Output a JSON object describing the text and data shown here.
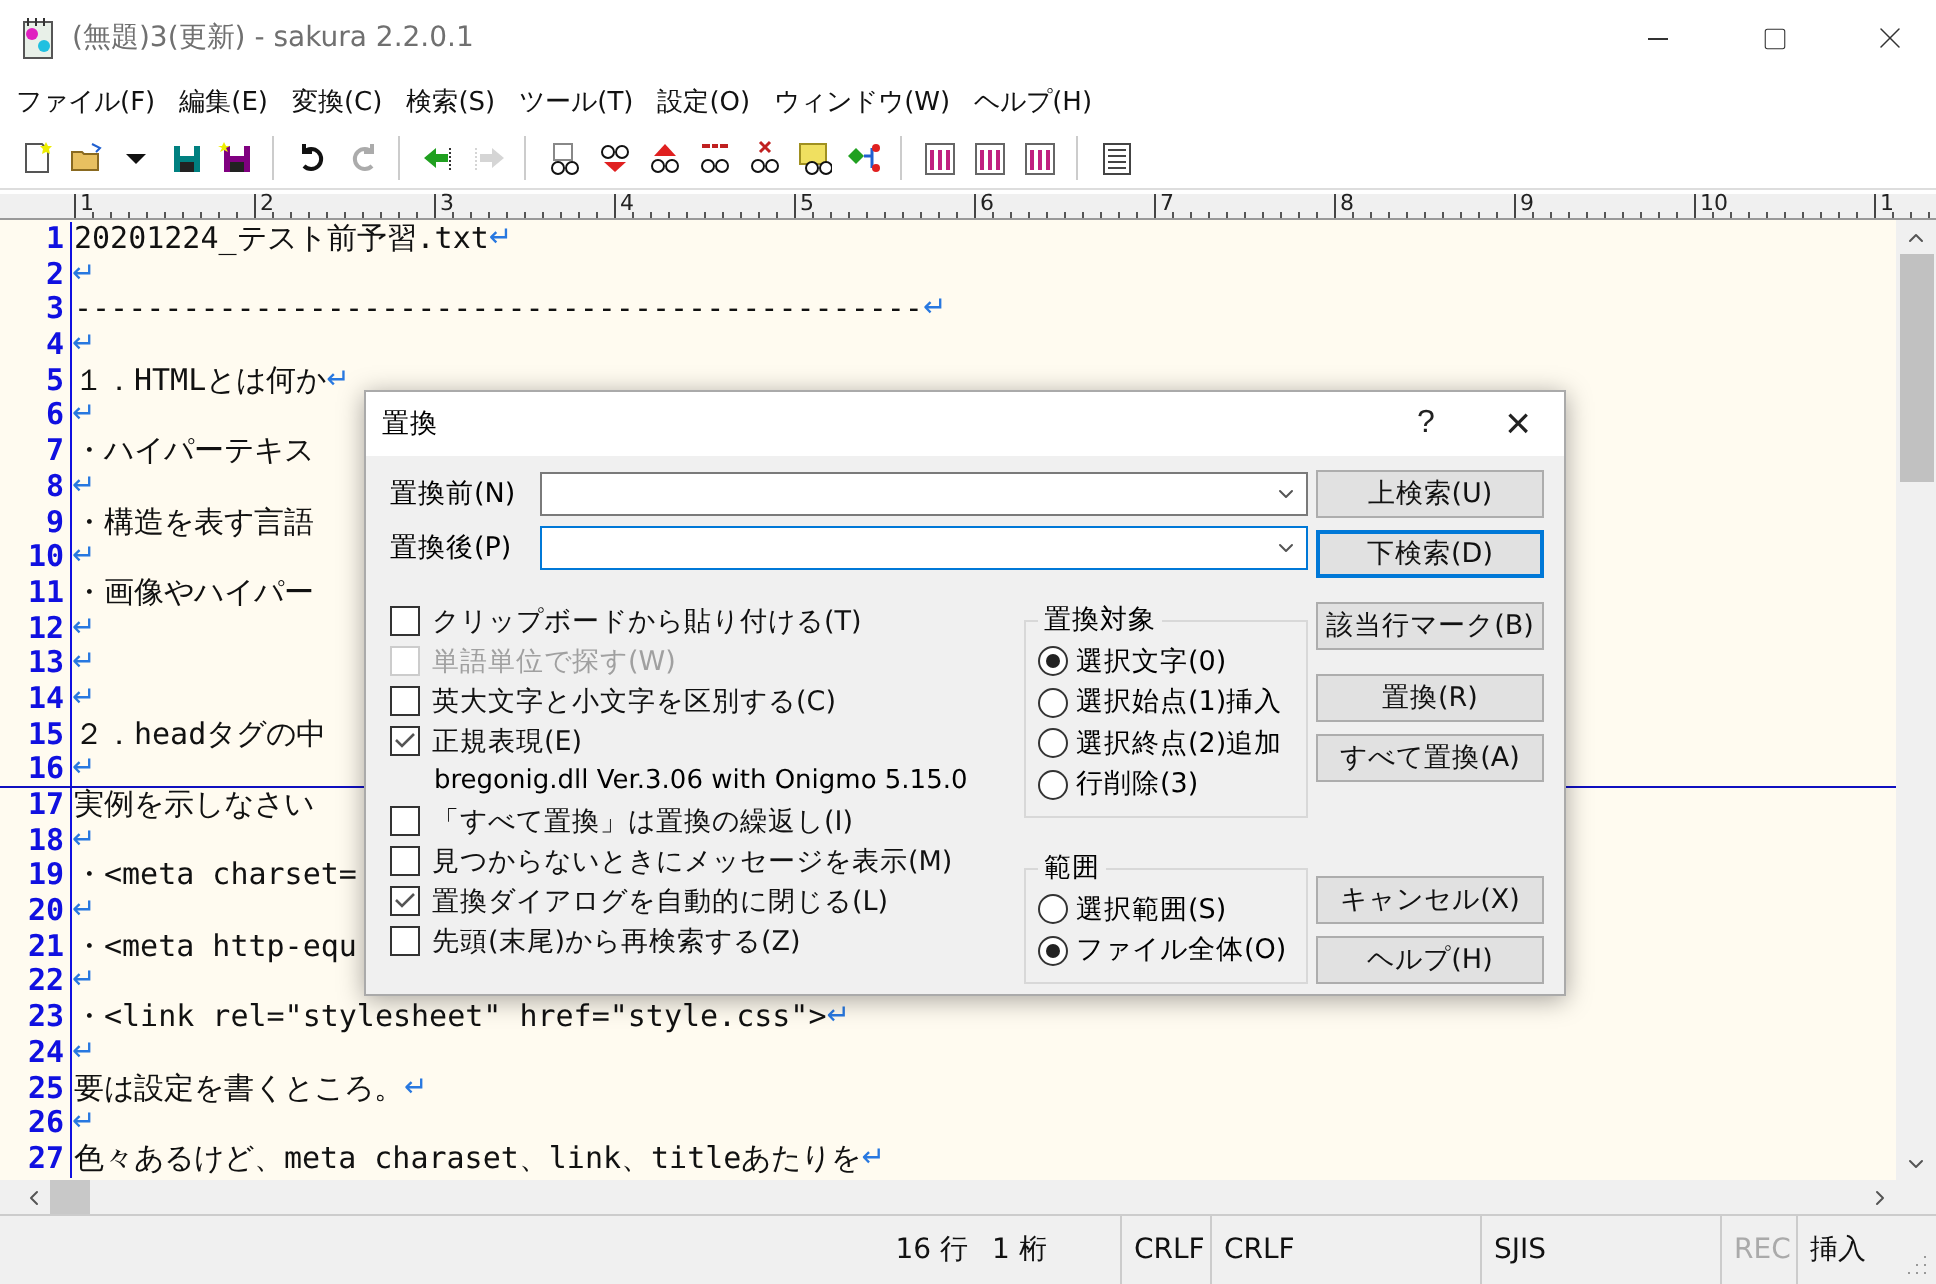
{
  "window": {
    "title": "(無題)3(更新) - sakura 2.2.0.1"
  },
  "menu": [
    "ファイル(F)",
    "編集(E)",
    "変換(C)",
    "検索(S)",
    "ツール(T)",
    "設定(O)",
    "ウィンドウ(W)",
    "ヘルプ(H)"
  ],
  "toolbar": [
    {
      "kind": "new",
      "disabled": false
    },
    {
      "kind": "open",
      "disabled": false
    },
    {
      "kind": "caret",
      "disabled": false
    },
    {
      "kind": "save",
      "disabled": false
    },
    {
      "kind": "saveas",
      "disabled": false
    },
    {
      "kind": "sep"
    },
    {
      "kind": "undo",
      "disabled": false
    },
    {
      "kind": "redo",
      "disabled": true
    },
    {
      "kind": "sep"
    },
    {
      "kind": "back",
      "disabled": false
    },
    {
      "kind": "forward",
      "disabled": true
    },
    {
      "kind": "sep"
    },
    {
      "kind": "find",
      "disabled": false
    },
    {
      "kind": "down",
      "disabled": false
    },
    {
      "kind": "up",
      "disabled": false
    },
    {
      "kind": "replace",
      "disabled": false
    },
    {
      "kind": "clear",
      "disabled": false
    },
    {
      "kind": "grep",
      "disabled": false
    },
    {
      "kind": "link",
      "disabled": false
    },
    {
      "kind": "sep"
    },
    {
      "kind": "tool",
      "disabled": false
    },
    {
      "kind": "tool",
      "disabled": false
    },
    {
      "kind": "tool",
      "disabled": false
    },
    {
      "kind": "sep"
    },
    {
      "kind": "list",
      "disabled": false
    }
  ],
  "ruler": {
    "marks": [
      "1",
      "2",
      "3",
      "4",
      "5",
      "6",
      "7",
      "8",
      "9",
      "10",
      "1"
    ]
  },
  "editor": {
    "lines": [
      {
        "num": "1",
        "text": "20201224_テスト前予習.txt",
        "eol": "↵",
        "current": false
      },
      {
        "num": "2",
        "eol": "↵",
        "current": false
      },
      {
        "num": "3",
        "text": "-----------------------------------------------",
        "eol": "↵",
        "current": false
      },
      {
        "num": "4",
        "eol": "↵",
        "current": false
      },
      {
        "num": "5",
        "text": "１．HTMLとは何か",
        "eol": "↵",
        "current": false
      },
      {
        "num": "6",
        "eol": "↵",
        "current": false
      },
      {
        "num": "7",
        "text": "・ハイパーテキス",
        "current": false
      },
      {
        "num": "8",
        "eol": "↵",
        "current": false
      },
      {
        "num": "9",
        "text": "・構造を表す言語",
        "current": false
      },
      {
        "num": "10",
        "eol": "↵",
        "current": false
      },
      {
        "num": "11",
        "text": "・画像やハイパー",
        "current": false
      },
      {
        "num": "12",
        "eol": "↵",
        "current": false
      },
      {
        "num": "13",
        "eol": "↵",
        "current": false
      },
      {
        "num": "14",
        "eol": "↵",
        "current": false
      },
      {
        "num": "15",
        "text": "２．headタグの中",
        "current": false
      },
      {
        "num": "16",
        "eol": "↵",
        "current": true
      },
      {
        "num": "17",
        "text": "実例を示しなさい",
        "current": false
      },
      {
        "num": "18",
        "eol": "↵",
        "current": false
      },
      {
        "num": "19",
        "text": "・<meta charset=",
        "current": false
      },
      {
        "num": "20",
        "eol": "↵",
        "current": false
      },
      {
        "num": "21",
        "text": "・<meta http-equ",
        "current": false
      },
      {
        "num": "22",
        "eol": "↵",
        "current": false
      },
      {
        "num": "23",
        "text": "・<link rel=\"stylesheet\" href=\"style.css\">",
        "eol": "↵",
        "current": false
      },
      {
        "num": "24",
        "eol": "↵",
        "current": false
      },
      {
        "num": "25",
        "text": "要は設定を書くところ。",
        "eol": "↵",
        "current": false
      },
      {
        "num": "26",
        "eol": "↵",
        "current": false
      },
      {
        "num": "27",
        "text": "色々あるけど、meta charaset、link、titleあたりを",
        "eol": "↵",
        "current": false
      }
    ]
  },
  "status_bar": [
    {
      "text": "16 行",
      "disabled": false
    },
    {
      "text": "1 桁",
      "disabled": false
    },
    {
      "text": "CRLF",
      "disabled": false
    },
    {
      "text": "CRLF",
      "disabled": false
    },
    {
      "text": "SJIS",
      "disabled": false
    },
    {
      "text": "REC",
      "disabled": true
    },
    {
      "text": "挿入",
      "disabled": false
    }
  ],
  "dialog": {
    "title": "置換",
    "help": "?",
    "close": "×",
    "fields": [
      {
        "label": "置換前(N)",
        "focused": false
      },
      {
        "label": "置換後(P)",
        "focused": true
      }
    ],
    "options": [
      {
        "kind": "checkbox",
        "label": "クリップボードから貼り付ける(T)",
        "checked": false,
        "disabled": false
      },
      {
        "kind": "checkbox",
        "label": "単語単位で探す(W)",
        "checked": false,
        "disabled": true
      },
      {
        "kind": "checkbox",
        "label": "英大文字と小文字を区別する(C)",
        "checked": false,
        "disabled": false
      },
      {
        "kind": "checkbox",
        "label": "正規表現(E)",
        "checked": true,
        "disabled": false
      },
      {
        "kind": "note",
        "label": "bregonig.dll Ver.3.06 with Onigmo 5.15.0"
      },
      {
        "kind": "checkbox",
        "label": "「すべて置換」は置換の繰返し(I)",
        "checked": false,
        "disabled": false
      },
      {
        "kind": "checkbox",
        "label": "見つからないときにメッセージを表示(M)",
        "checked": false,
        "disabled": false
      },
      {
        "kind": "checkbox",
        "label": "置換ダイアログを自動的に閉じる(L)",
        "checked": true,
        "disabled": false
      },
      {
        "kind": "checkbox",
        "label": "先頭(末尾)から再検索する(Z)",
        "checked": false,
        "disabled": false
      }
    ],
    "groups": [
      {
        "title": "置換対象",
        "radios": [
          {
            "label": "選択文字(0)",
            "selected": true
          },
          {
            "label": "選択始点(1)挿入",
            "selected": false
          },
          {
            "label": "選択終点(2)追加",
            "selected": false
          },
          {
            "label": "行削除(3)",
            "selected": false
          }
        ]
      },
      {
        "title": "範囲",
        "radios": [
          {
            "label": "選択範囲(S)",
            "selected": false
          },
          {
            "label": "ファイル全体(O)",
            "selected": true
          }
        ]
      }
    ],
    "button_groups": [
      [
        {
          "label": "上検索(U)",
          "default": false
        },
        {
          "label": "下検索(D)",
          "default": true
        }
      ],
      [
        {
          "label": "該当行マーク(B)",
          "default": false
        }
      ],
      [
        {
          "label": "置換(R)",
          "default": false
        },
        {
          "label": "すべて置換(A)",
          "default": false
        }
      ],
      [
        {
          "label": "キャンセル(X)",
          "default": false
        },
        {
          "label": "ヘルプ(H)",
          "default": false
        }
      ]
    ]
  }
}
